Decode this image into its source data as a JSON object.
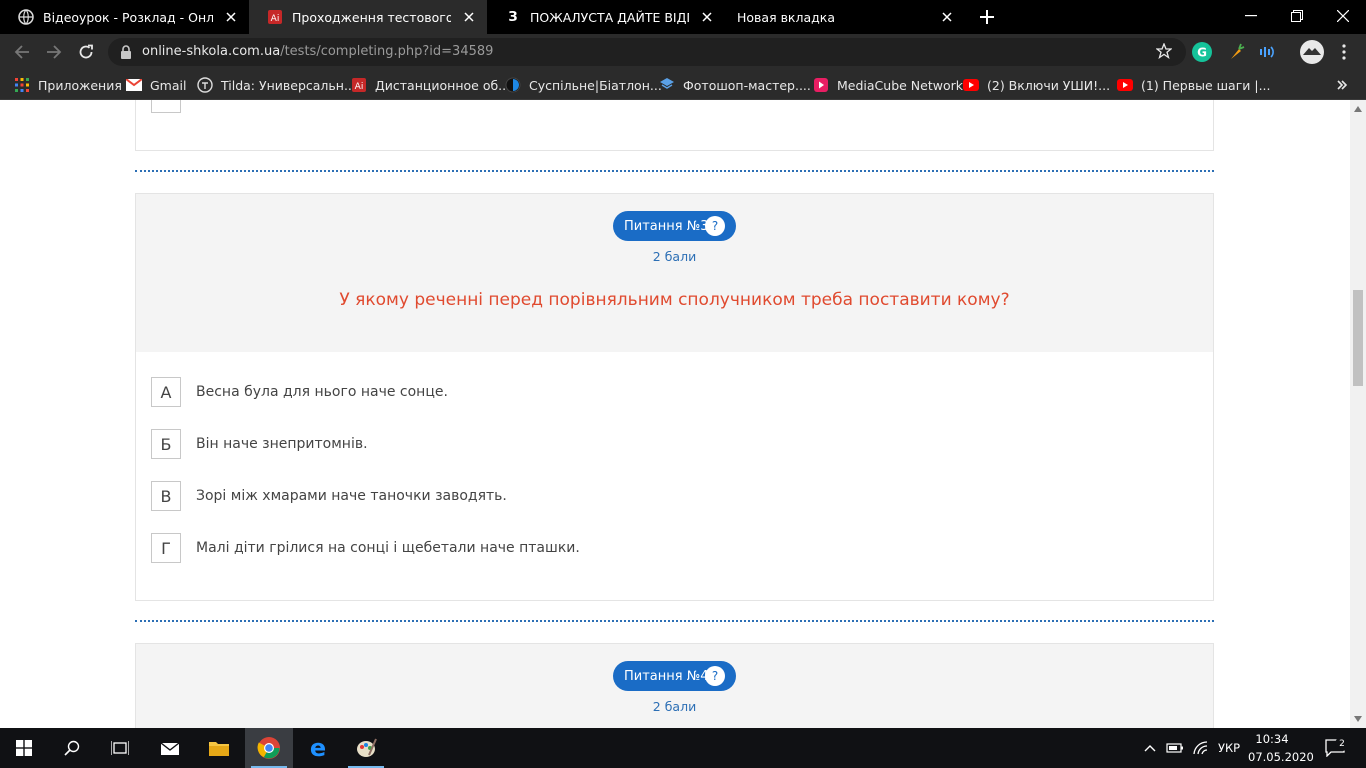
{
  "browser": {
    "tabs": [
      {
        "title": "Відеоурок - Розклад - Онлайн-Ш",
        "icon": "globe-icon"
      },
      {
        "title": "Проходження тестового ДЗ - Он",
        "icon": "site-favicon",
        "active": true
      },
      {
        "title": "ПОЖАЛУСТА ДАЙТЕ ВІДПОВІДЬ",
        "icon": "znanija-favicon",
        "favicon_text": "З"
      },
      {
        "title": "Новая вкладка",
        "icon": "none"
      }
    ],
    "url_host": "online-shkola.com.ua",
    "url_path": "/tests/completing.php?id=34589",
    "bookmarks": [
      {
        "label": "Приложения",
        "icon": "apps-grid-icon"
      },
      {
        "label": "Gmail",
        "icon": "gmail-icon"
      },
      {
        "label": "Tilda: Универсальн...",
        "icon": "tilda-icon"
      },
      {
        "label": "Дистанционное об...",
        "icon": "site-favicon"
      },
      {
        "label": "Суспільне|Біатлон...",
        "icon": "suspilne-icon"
      },
      {
        "label": "Фотошоп-мастер....",
        "icon": "photoshop-icon"
      },
      {
        "label": "MediaCube Network",
        "icon": "mediacube-icon"
      },
      {
        "label": "(2) Включи УШИ!...",
        "icon": "youtube-icon"
      },
      {
        "label": "(1) Первые шаги |...",
        "icon": "youtube-icon"
      }
    ]
  },
  "page": {
    "question3": {
      "badge": "Питання №3",
      "help": "?",
      "points": "2 бали",
      "text": "У якому реченні перед порівняльним сполучником треба поставити кому?",
      "answers": [
        {
          "letter": "А",
          "text": "Весна була для нього наче сонце."
        },
        {
          "letter": "Б",
          "text": "Він наче знепритомнів."
        },
        {
          "letter": "В",
          "text": "Зорі між хмарами наче таночки заводять."
        },
        {
          "letter": "Г",
          "text": "Малі діти грілися на сонці і щебетали наче пташки."
        }
      ]
    },
    "question4": {
      "badge": "Питання №4",
      "help": "?",
      "points": "2 бали"
    }
  },
  "taskbar": {
    "language": "УКР",
    "time": "10:34",
    "date": "07.05.2020",
    "notifications": "2"
  },
  "colors": {
    "accent": "#1a6cc6",
    "question_text": "#e04a2f",
    "dotted_separator": "#2c6fb5"
  }
}
